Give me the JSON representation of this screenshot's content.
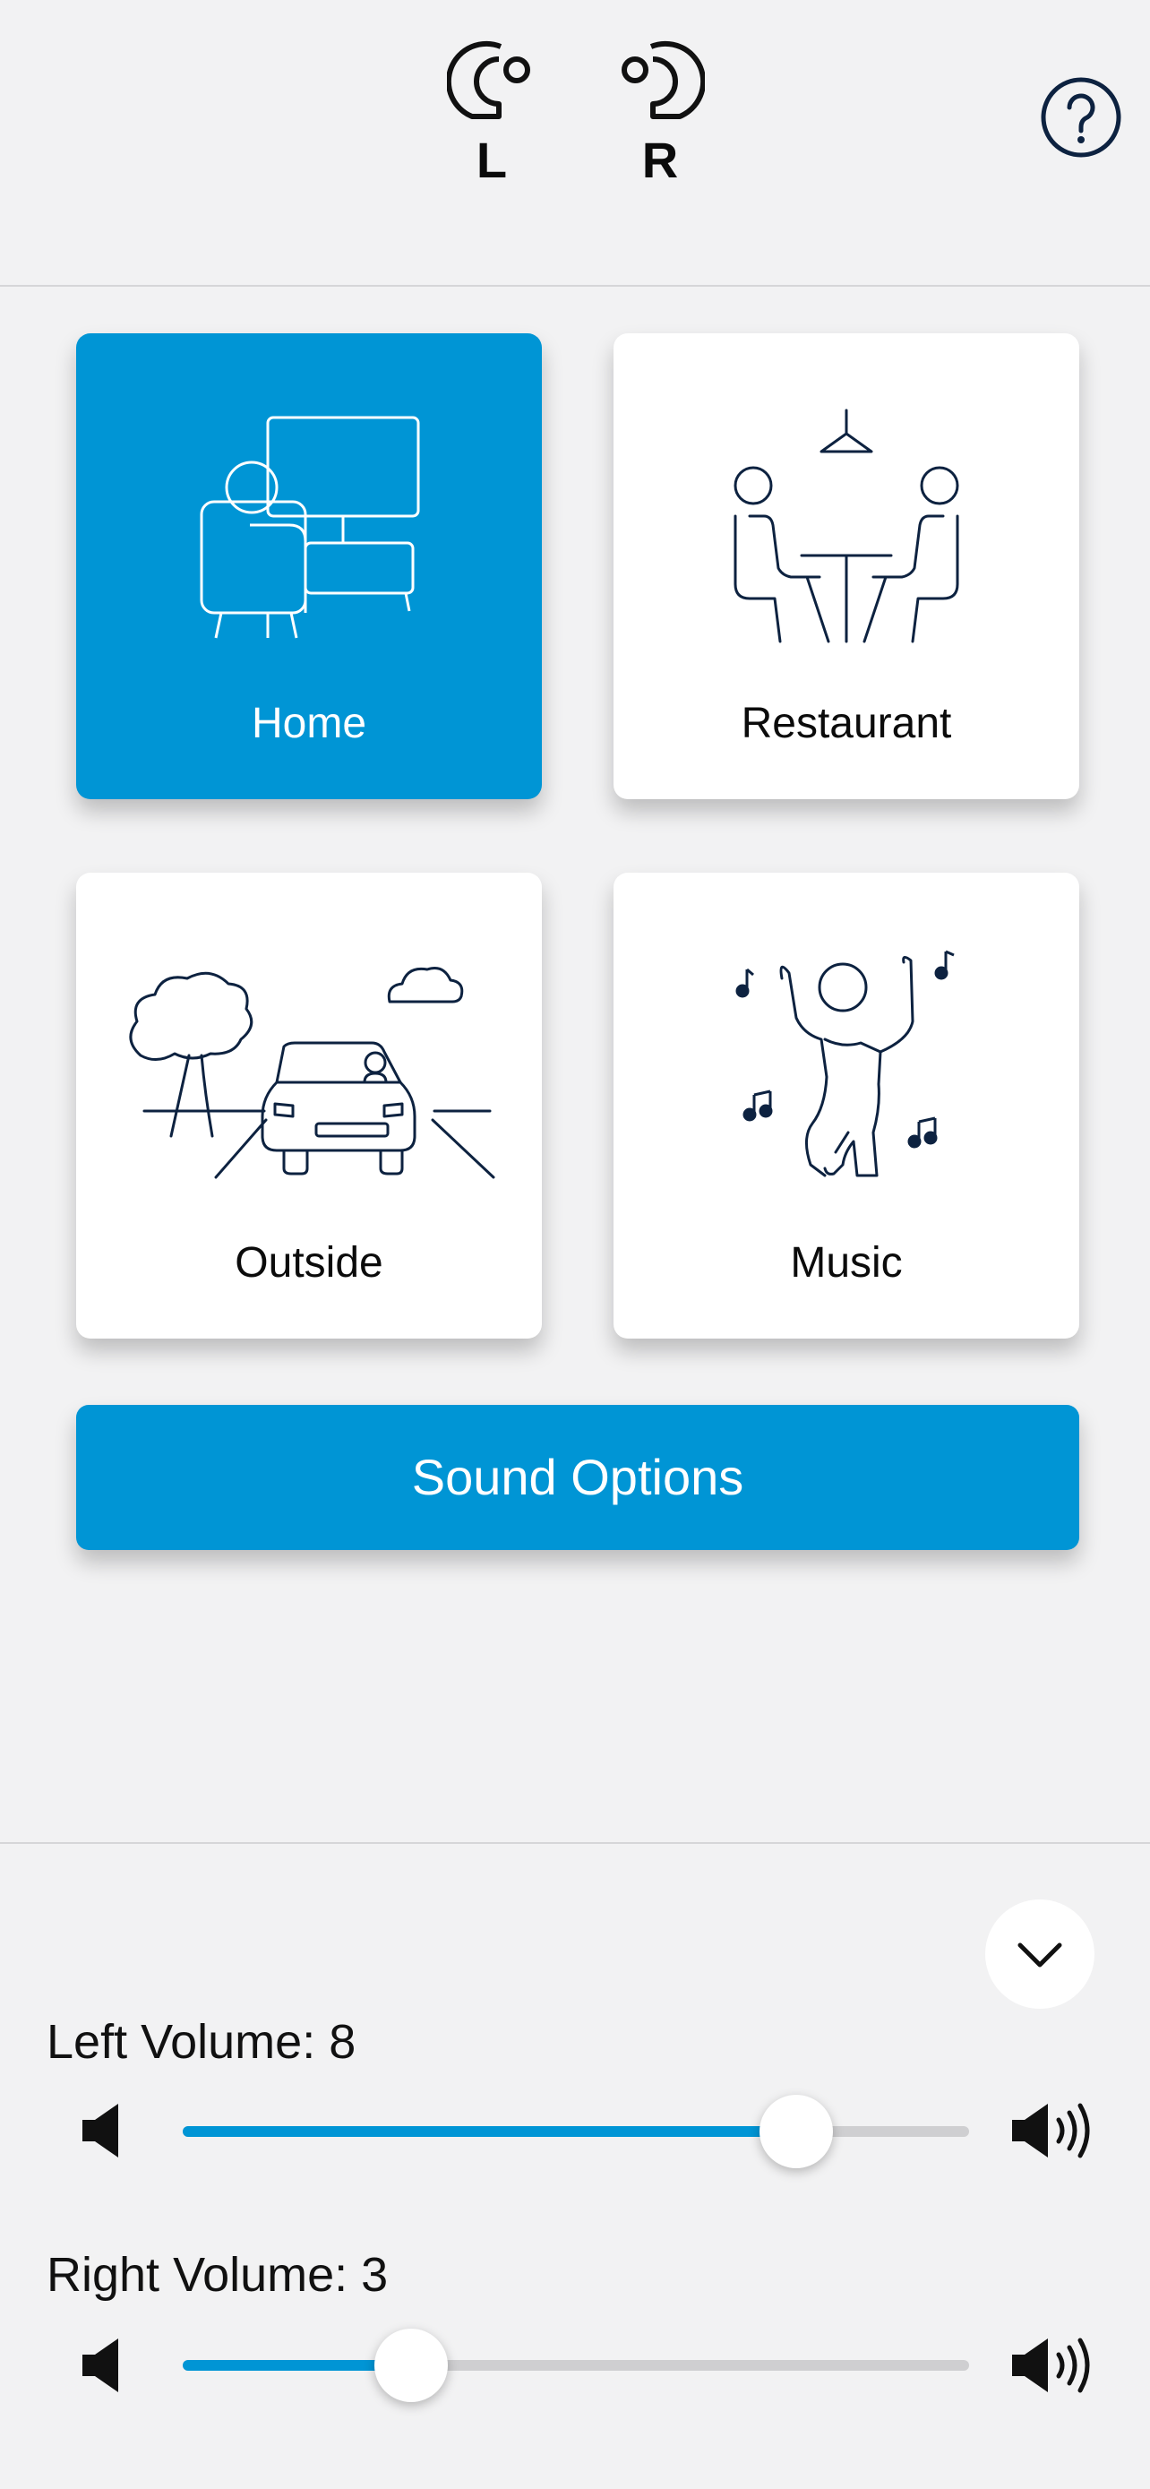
{
  "header": {
    "left_aid": {
      "label": "L",
      "icon": "left-hearing-aid-icon"
    },
    "right_aid": {
      "label": "R",
      "icon": "right-hearing-aid-icon"
    },
    "help_icon": "question-mark-icon"
  },
  "programs": [
    {
      "label": "Home",
      "icon": "sofa-tv-icon",
      "active": true
    },
    {
      "label": "Restaurant",
      "icon": "dining-table-icon",
      "active": false
    },
    {
      "label": "Outside",
      "icon": "car-road-icon",
      "active": false
    },
    {
      "label": "Music",
      "icon": "dancing-person-icon",
      "active": false
    }
  ],
  "sound_options": {
    "label": "Sound Options"
  },
  "volume": {
    "collapse_icon": "chevron-down-icon",
    "left": {
      "label": "Left Volume: 8",
      "level_fraction": 0.78
    },
    "right": {
      "label": "Right Volume: 3",
      "level_fraction": 0.29
    }
  },
  "colors": {
    "accent": "#0095d5",
    "background": "#f2f2f3",
    "icon_dark": "#0d2240",
    "track": "#cfcfd1"
  }
}
